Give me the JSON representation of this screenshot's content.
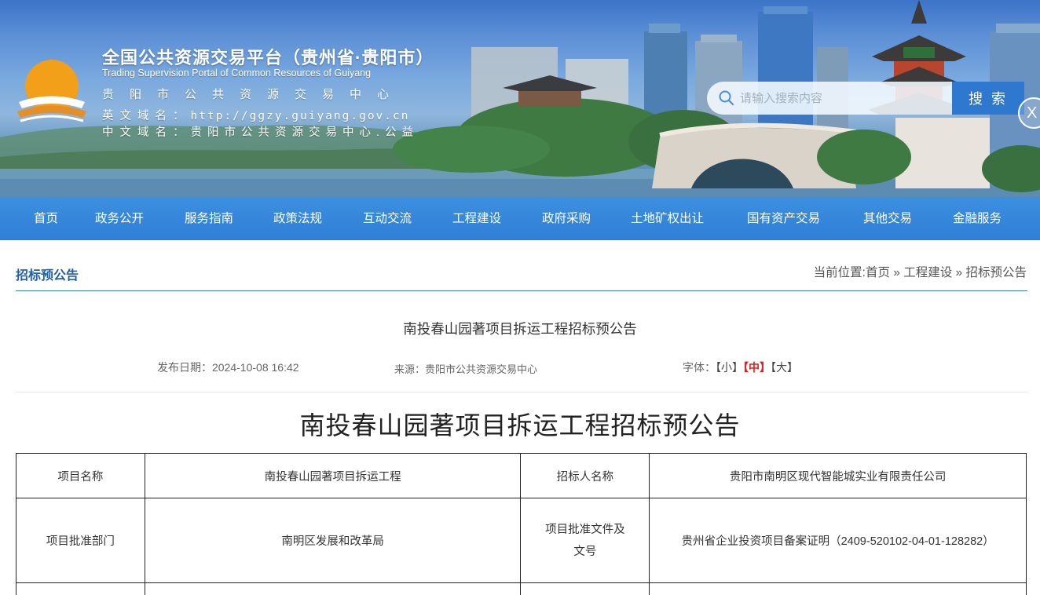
{
  "banner": {
    "title_cn": "全国公共资源交易平台（贵州省·贵阳市）",
    "title_en": "Trading Supervision Portal of Common Resources of Guiyang",
    "center_name": "贵阳市公共资源交易中心",
    "en_domain_label": "英文域名：",
    "en_domain_value": "http://ggzy.guiyang.gov.cn",
    "cn_domain_label": "中文域名：",
    "cn_domain_value": "贵阳市公共资源交易中心.公益",
    "landmark_sign": "甲秀楼"
  },
  "search": {
    "placeholder": "请输入搜索内容",
    "button_label": "搜 索",
    "close_glyph": "X"
  },
  "nav": {
    "items": [
      "首页",
      "政务公开",
      "服务指南",
      "政策法规",
      "互动交流",
      "工程建设",
      "政府采购",
      "土地矿权出让",
      "国有资产交易",
      "其他交易",
      "金融服务"
    ]
  },
  "section": {
    "title": "招标预公告",
    "breadcrumb_prefix": "当前位置:",
    "breadcrumb": [
      "首页",
      "工程建设",
      "招标预公告"
    ],
    "separator": " » "
  },
  "article": {
    "title": "南投春山园著项目拆运工程招标预公告",
    "publish_label": "发布日期：",
    "publish_date": "2024-10-08 16:42",
    "source_label": "来源：",
    "source": "贵阳市公共资源交易中心",
    "font_label": "字体：",
    "font_sizes": [
      "【小】",
      "【中】",
      "【大】"
    ],
    "active_font_size": "【中】",
    "heading": "南投春山园著项目拆运工程招标预公告"
  },
  "table": {
    "rows": [
      [
        "项目名称",
        "南投春山园著项目拆运工程",
        "招标人名称",
        "贵阳市南明区现代智能城实业有限责任公司"
      ],
      [
        "项目批准部门",
        "南明区发展和改革局",
        "项目批准文件及文号",
        "贵州省企业投资项目备案证明（2409-520102-04-01-128282）"
      ]
    ]
  },
  "colors": {
    "nav_blue": "#2e7fd6",
    "section_title": "#1f5fa8",
    "active_font_red": "#e02020",
    "search_button": "#2f78d0"
  }
}
